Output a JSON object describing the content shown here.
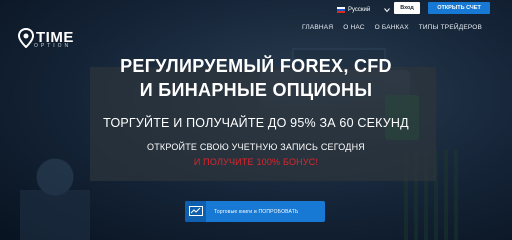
{
  "header": {
    "logo_text": "TIME",
    "logo_sub": "OPTION",
    "language": {
      "label": "Русский",
      "flag": "flag-ru-icon"
    },
    "login_label": "Вход",
    "open_account_label": "ОТКРЫТЬ СЧЕТ",
    "nav": [
      "ГЛАВНАЯ",
      "О НАС",
      "О БАНКАХ",
      "ТИПЫ ТРЕЙДЕРОВ"
    ]
  },
  "hero": {
    "title_line1": "РЕГУЛИРУЕМЫЙ FOREX, CFD",
    "title_line2": "И БИНАРНЫЕ ОПЦИОНЫ",
    "subtitle": "ТОРГУЙТЕ И ПОЛУЧАЙТЕ ДО 95% ЗА 60 СЕКУНД",
    "cta_text": "ОТКРОЙТЕ СВОЮ УЧЕТНУЮ ЗАПИСЬ СЕГОДНЯ",
    "bonus_text": "И ПОЛУЧИТЕ 100% БОНУС!",
    "demo_button_label": "Торговые книги и ПОПРОБОВАТЬ"
  },
  "colors": {
    "accent": "#1779d3",
    "bonus": "#e0242a",
    "background": "#0b1a2e"
  }
}
